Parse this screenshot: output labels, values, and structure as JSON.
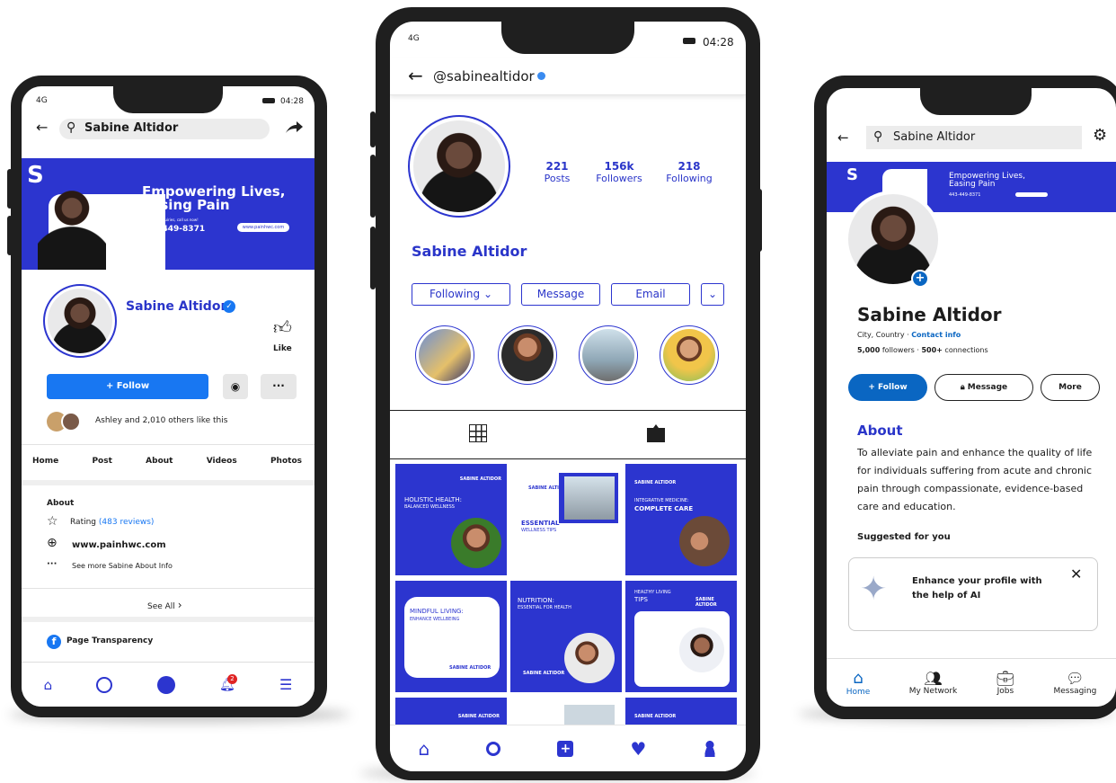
{
  "left": {
    "signal": "4G",
    "time": "04:28",
    "search": "Sabine Altidor",
    "banner_headline": "Empowering Lives, Easing Pain",
    "banner_small": "For more inquiries, call us now!",
    "banner_phone": "443-449-8371",
    "banner_url": "www.painhwc.com",
    "name": "Sabine Altidor",
    "like": "Like",
    "follow": "+ Follow",
    "likes_text": "Ashley and 2,010 others like this",
    "tabs": [
      "Home",
      "Post",
      "About",
      "Videos",
      "Photos"
    ],
    "about_heading": "About",
    "rating_label": "Rating",
    "rating_reviews": "(483 reviews)",
    "website": "www.painhwc.com",
    "see_more": "See more Sabine About Info",
    "see_all": "See All",
    "page_transparency": "Page Transparency",
    "notif_count": "2"
  },
  "middle": {
    "signal": "4G",
    "time": "04:28",
    "handle": "@sabinealtidor",
    "posts_n": "221",
    "posts_l": "Posts",
    "followers_n": "156k",
    "followers_l": "Followers",
    "following_n": "218",
    "following_l": "Following",
    "name": "Sabine Altidor",
    "following_btn": "Following",
    "message_btn": "Message",
    "email_btn": "Email",
    "tiles": [
      {
        "brand": "SABINE ALTIDOR",
        "title": "HOLISTIC HEALTH:",
        "subtitle": "BALANCED WELLNESS"
      },
      {
        "brand": "SABINE ALTIDOR",
        "title": "ESSENTIAL",
        "subtitle": "WELLNESS TIPS"
      },
      {
        "brand": "SABINE ALTIDOR",
        "title": "INTEGRATIVE MEDICINE:",
        "subtitle": "COMPLETE CARE"
      },
      {
        "brand": "SABINE ALTIDOR",
        "title": "MINDFUL LIVING:",
        "subtitle": "ENHANCE WELLBEING"
      },
      {
        "brand": "SABINE ALTIDOR",
        "title": "NUTRITION:",
        "subtitle": "ESSENTIAL FOR HEALTH"
      },
      {
        "brand": "SABINE ALTIDOR",
        "title": "HEALTHY LIVING",
        "subtitle": "TIPS"
      }
    ],
    "bottom_brand": "SABINE ALTIDOR"
  },
  "right": {
    "search": "Sabine Altidor",
    "banner_headline": "Empowering Lives, Easing Pain",
    "banner_phone": "443-449-8371",
    "name": "Sabine Altidor",
    "location": "City, Country · ",
    "contact": "Contact info",
    "followers": "5,000",
    "followers_l": " followers · ",
    "connections": "500+",
    "connections_l": " connections",
    "follow": "+ Follow",
    "message": "Message",
    "more": "More",
    "about_heading": "About",
    "about_text": "To alleviate pain and enhance the quality of life for individuals suffering from acute and chronic pain through compassionate, evidence-based care and education.",
    "suggested": "Suggested for you",
    "ai_card": "Enhance your profile with the help of AI",
    "nav": [
      "Home",
      "My Network",
      "Jobs",
      "Messaging"
    ]
  },
  "colors": {
    "brand_blue": "#2c35cf",
    "fb_blue": "#1877f2",
    "li_blue": "#0a66c2"
  }
}
